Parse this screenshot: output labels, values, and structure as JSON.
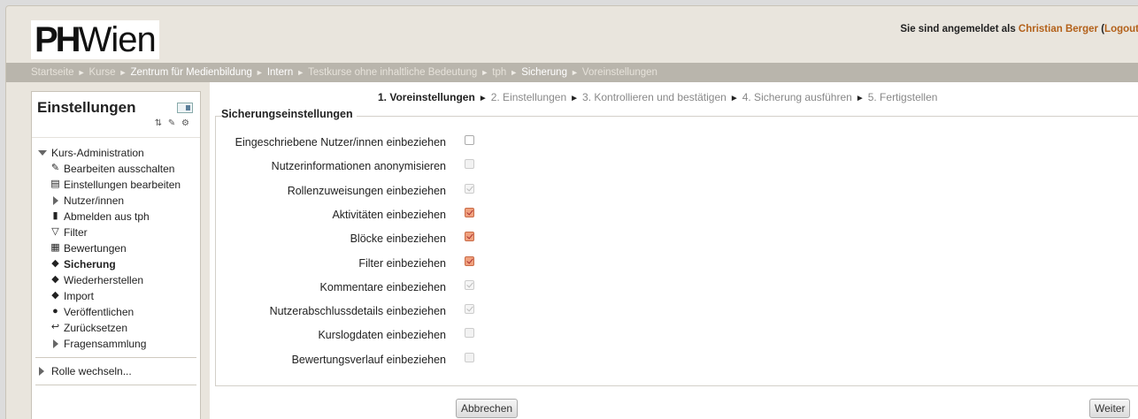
{
  "header": {
    "logo_bold": "PH",
    "logo_text": "Wien",
    "login_prefix": "Sie sind angemeldet als ",
    "login_user": "Christian Berger",
    "login_paren_open": " (",
    "login_logout": "Logout"
  },
  "breadcrumb": [
    {
      "label": "Startseite",
      "dim": true
    },
    {
      "label": "Kurse",
      "dim": true
    },
    {
      "label": "Zentrum für Medienbildung",
      "dim": false
    },
    {
      "label": "Intern",
      "dim": false
    },
    {
      "label": "Testkurse ohne inhaltliche Bedeutung",
      "dim": true
    },
    {
      "label": "tph",
      "dim": true
    },
    {
      "label": "Sicherung",
      "dim": false
    },
    {
      "label": "Voreinstellungen",
      "dim": true
    }
  ],
  "sidebar": {
    "title": "Einstellungen",
    "items": [
      {
        "label": "Kurs-Administration",
        "type": "top-open"
      },
      {
        "label": "Bearbeiten ausschalten",
        "icon": "edit-icon",
        "glyph": "✎"
      },
      {
        "label": "Einstellungen bearbeiten",
        "icon": "settings-doc-icon",
        "glyph": "▤"
      },
      {
        "label": "Nutzer/innen",
        "type": "sub-collapsed"
      },
      {
        "label": "Abmelden aus tph",
        "icon": "door-icon",
        "glyph": "▮"
      },
      {
        "label": "Filter",
        "icon": "funnel-icon",
        "glyph": "▽"
      },
      {
        "label": "Bewertungen",
        "icon": "grades-icon",
        "glyph": "▦"
      },
      {
        "label": "Sicherung",
        "icon": "backup-icon",
        "glyph": "◆",
        "bold": true
      },
      {
        "label": "Wiederherstellen",
        "icon": "restore-icon",
        "glyph": "◆"
      },
      {
        "label": "Import",
        "icon": "import-icon",
        "glyph": "◆"
      },
      {
        "label": "Veröffentlichen",
        "icon": "globe-icon",
        "glyph": "●"
      },
      {
        "label": "Zurücksetzen",
        "icon": "reset-arrow-icon",
        "glyph": "↩"
      },
      {
        "label": "Fragensammlung",
        "type": "sub-collapsed"
      }
    ],
    "switch_role": "Rolle wechseln..."
  },
  "progress": {
    "steps": [
      "1. Voreinstellungen",
      "2. Einstellungen",
      "3. Kontrollieren und bestätigen",
      "4. Sicherung ausführen",
      "5. Fertigstellen"
    ]
  },
  "form": {
    "legend": "Sicherungseinstellungen",
    "options": [
      {
        "label": "Eingeschriebene Nutzer/innen einbeziehen",
        "state": "unchecked"
      },
      {
        "label": "Nutzerinformationen anonymisieren",
        "state": "disabled"
      },
      {
        "label": "Rollenzuweisungen einbeziehen",
        "state": "checked-disabled"
      },
      {
        "label": "Aktivitäten einbeziehen",
        "state": "checked"
      },
      {
        "label": "Blöcke einbeziehen",
        "state": "checked"
      },
      {
        "label": "Filter einbeziehen",
        "state": "checked"
      },
      {
        "label": "Kommentare einbeziehen",
        "state": "checked-disabled"
      },
      {
        "label": "Nutzerabschlussdetails einbeziehen",
        "state": "checked-disabled"
      },
      {
        "label": "Kurslogdaten einbeziehen",
        "state": "disabled"
      },
      {
        "label": "Bewertungsverlauf einbeziehen",
        "state": "disabled"
      }
    ],
    "cancel_label": "Abbrechen",
    "next_label": "Weiter"
  }
}
